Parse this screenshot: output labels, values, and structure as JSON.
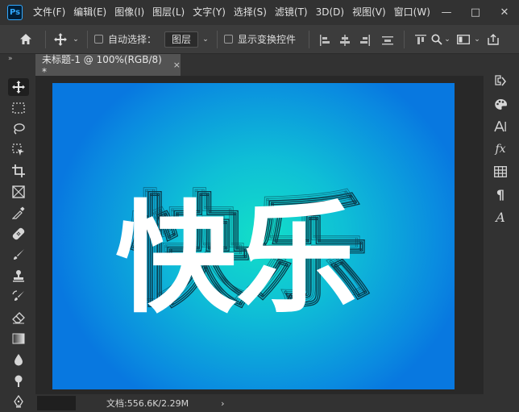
{
  "app": {
    "logo": "Ps"
  },
  "menu": [
    "文件(F)",
    "编辑(E)",
    "图像(I)",
    "图层(L)",
    "文字(Y)",
    "选择(S)",
    "滤镜(T)",
    "3D(D)",
    "视图(V)",
    "窗口(W)"
  ],
  "window_controls": {
    "minimize": "—",
    "maximize": "□",
    "close": "✕"
  },
  "options": {
    "home_icon": "home-icon",
    "auto_select_label": "自动选择：",
    "auto_select_value": "图层",
    "show_transform_label": "显示变换控件"
  },
  "document": {
    "tab_title": "未标题-1 @ 100%(RGB/8) *",
    "close": "×"
  },
  "canvas": {
    "text": "快乐",
    "text_color": "#ffffff",
    "gradient_center": "#12dfc8",
    "gradient_edge": "#0878e0"
  },
  "status": {
    "doc_size": "文档:556.6K/2.29M",
    "arrow": "›"
  },
  "strip": {
    "left_chevron": "»",
    "right_chevron": "»"
  }
}
